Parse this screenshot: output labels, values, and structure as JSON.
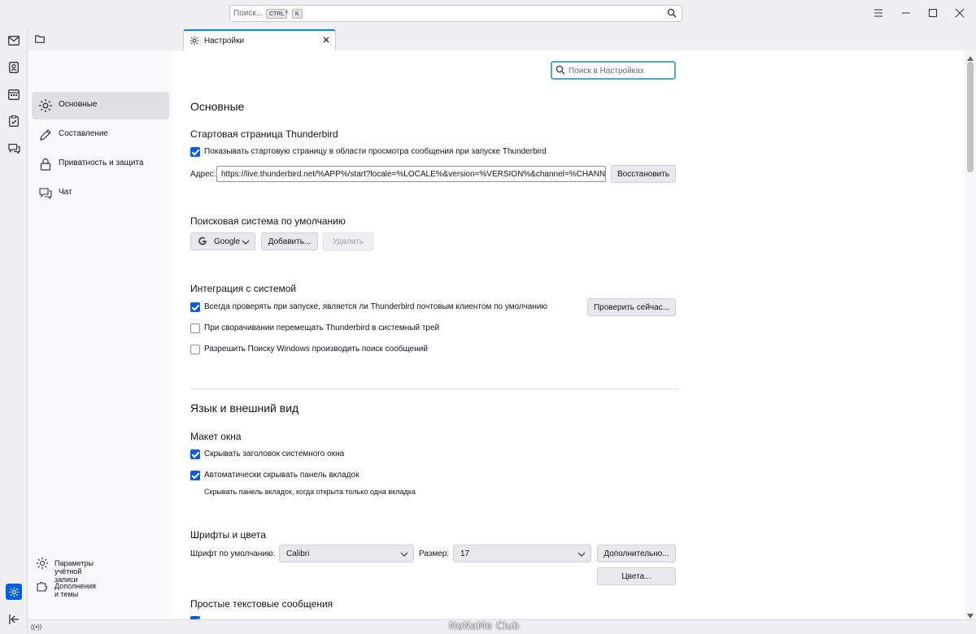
{
  "titlebar": {
    "search_placeholder": "Поиск...",
    "shortcut_key1": "CTRL",
    "shortcut_plus": "+",
    "shortcut_key2": "K"
  },
  "spaces": [
    "mail-icon",
    "address-book-icon",
    "calendar-icon",
    "tasks-icon",
    "chat-icon"
  ],
  "tab": {
    "label": "Настройки"
  },
  "categories": {
    "general": "Основные",
    "compose": "Составление",
    "privacy": "Приватность и защита",
    "chat": "Чат",
    "account_settings": "Параметры учётной записи",
    "addons": "Дополнения и темы"
  },
  "pref_search": {
    "placeholder": "Поиск в Настройках"
  },
  "general": {
    "heading": "Основные",
    "start_page": {
      "title": "Стартовая страница Thunderbird",
      "show_checkbox": "Показывать стартовую страницу в области просмотра сообщения при запуске Thunderbird",
      "show_checked": true,
      "address_label": "Адрес:",
      "address_value": "https://live.thunderbird.net/%APP%/start?locale=%LOCALE%&version=%VERSION%&channel=%CHANNEL%",
      "restore_button": "Восстановить"
    },
    "search_engine": {
      "title": "Поисковая система по умолчанию",
      "selected": "Google",
      "add_button": "Добавить...",
      "remove_button": "Удалить"
    },
    "integration": {
      "title": "Интеграция с системой",
      "check_default": "Всегда проверять при запуске, является ли Thunderbird почтовым клиентом по умолчанию",
      "check_default_checked": true,
      "check_now_button": "Проверить сейчас...",
      "minimize_tray": "При сворачивании перемещать Thunderbird в системный трей",
      "minimize_tray_checked": false,
      "windows_search": "Разрешить Поиску Windows производить поиск сообщений",
      "windows_search_checked": false
    }
  },
  "appearance": {
    "heading": "Язык и внешний вид",
    "window_layout": {
      "title": "Макет окна",
      "hide_titlebar": "Скрывать заголовок системного окна",
      "hide_titlebar_checked": true,
      "autohide_tabs": "Автоматически скрывать панель вкладок",
      "autohide_tabs_checked": true,
      "autohide_hint": "Скрывать панель вкладок, когда открыта только одна вкладка"
    },
    "fonts": {
      "title": "Шрифты и цвета",
      "default_font_label": "Шрифт по умолчанию:",
      "default_font": "Calibri",
      "size_label": "Размер:",
      "size": "17",
      "advanced_button": "Дополнительно...",
      "colors_button": "Цвета..."
    },
    "plain_text": {
      "title": "Простые текстовые сообщения"
    }
  },
  "statusbar": {
    "icon_text": "((•))",
    "watermark": "NoNaMe Club"
  },
  "colors": {
    "accent": "#0060df",
    "tab_accent": "#0a84ff",
    "checkbox": "#0a5dd8"
  }
}
